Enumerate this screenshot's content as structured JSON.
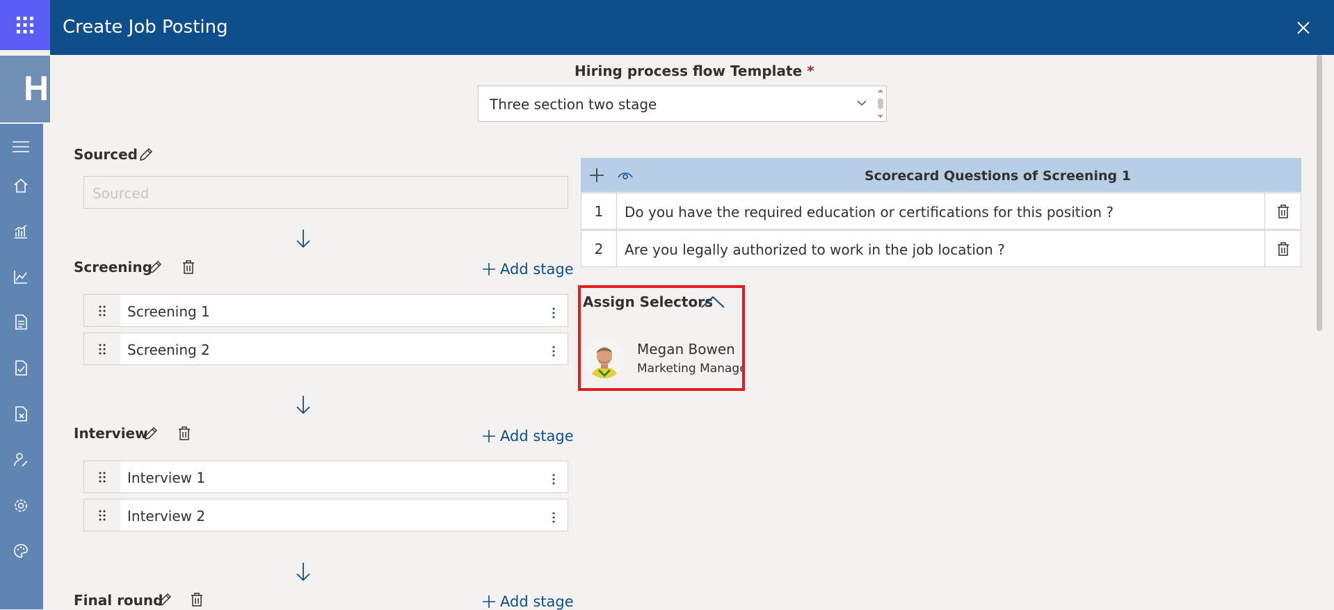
{
  "app": {
    "banner_fragment": "HI"
  },
  "dialog": {
    "title": "Create Job Posting",
    "template_label": "Hiring process flow Template",
    "template_required_mark": "*",
    "template_value": "Three section two stage"
  },
  "stages": {
    "sourced": {
      "title": "Sourced",
      "placeholder": "Sourced"
    },
    "screening": {
      "title": "Screening",
      "add_label": "Add stage",
      "items": [
        "Screening 1",
        "Screening 2"
      ]
    },
    "interview": {
      "title": "Interview",
      "add_label": "Add stage",
      "items": [
        "Interview 1",
        "Interview 2"
      ]
    },
    "final": {
      "title": "Final round",
      "add_label": "Add stage"
    }
  },
  "scorecard": {
    "title": "Scorecard Questions of Screening 1",
    "rows": [
      {
        "num": "1",
        "question": "Do you have the required education or certifications for this position ?"
      },
      {
        "num": "2",
        "question": "Are you legally authorized to work in the job location ?"
      }
    ]
  },
  "assign": {
    "title": "Assign Selectors",
    "person": {
      "name": "Megan Bowen",
      "role": "Marketing Manager"
    }
  },
  "icons": [
    "waffle-icon",
    "menu-icon",
    "home-icon",
    "analytics-icon",
    "line-chart-icon",
    "document-icon",
    "document-check-icon",
    "document-remove-icon",
    "person-edit-icon",
    "settings-icon",
    "palette-icon",
    "close-icon",
    "pencil-icon",
    "trash-icon",
    "add-icon",
    "eye-icon",
    "gripper-icon",
    "more-vertical-icon",
    "arrow-down-icon",
    "chevron-up-icon",
    "chevron-down-icon"
  ],
  "colors": {
    "header": "#0e4f8b",
    "accent": "#0e4f8b",
    "scorecard_header": "#b7cfe6",
    "highlight": "#e31d1d",
    "rail": "#5f85b3"
  }
}
